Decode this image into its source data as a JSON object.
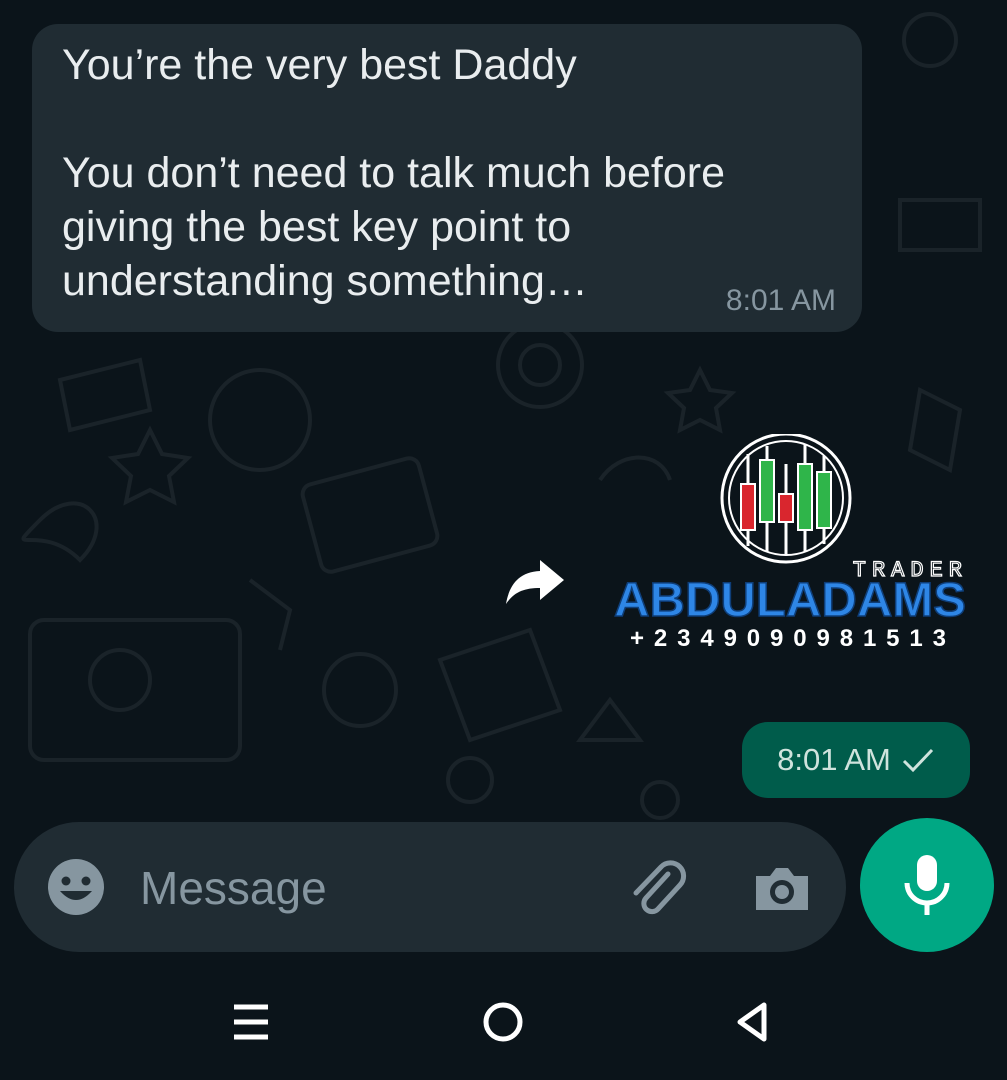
{
  "chat": {
    "incoming_message": {
      "text": "You’re the very best Daddy\n\nYou don’t need to talk much before giving the best key point to understanding something…",
      "time": "8:01 AM"
    },
    "outgoing_image": {
      "logo_top_text": "TRADER",
      "logo_name": "ABDULADAMS",
      "logo_phone": "+2349090981513",
      "time": "8:01 AM",
      "status_icon": "single-check-icon"
    }
  },
  "composer": {
    "placeholder": "Message",
    "value": "",
    "emoji_icon": "emoji-icon",
    "attach_icon": "paperclip-icon",
    "camera_icon": "camera-icon",
    "mic_icon": "microphone-icon"
  },
  "nav": {
    "recent_icon": "recent-apps-icon",
    "home_icon": "home-icon",
    "back_icon": "back-icon"
  },
  "colors": {
    "background": "#0b141a",
    "incoming_bubble": "#202c33",
    "outgoing_bubble": "#005c4b",
    "accent": "#00a884",
    "logo_blue": "#2e86e6"
  }
}
